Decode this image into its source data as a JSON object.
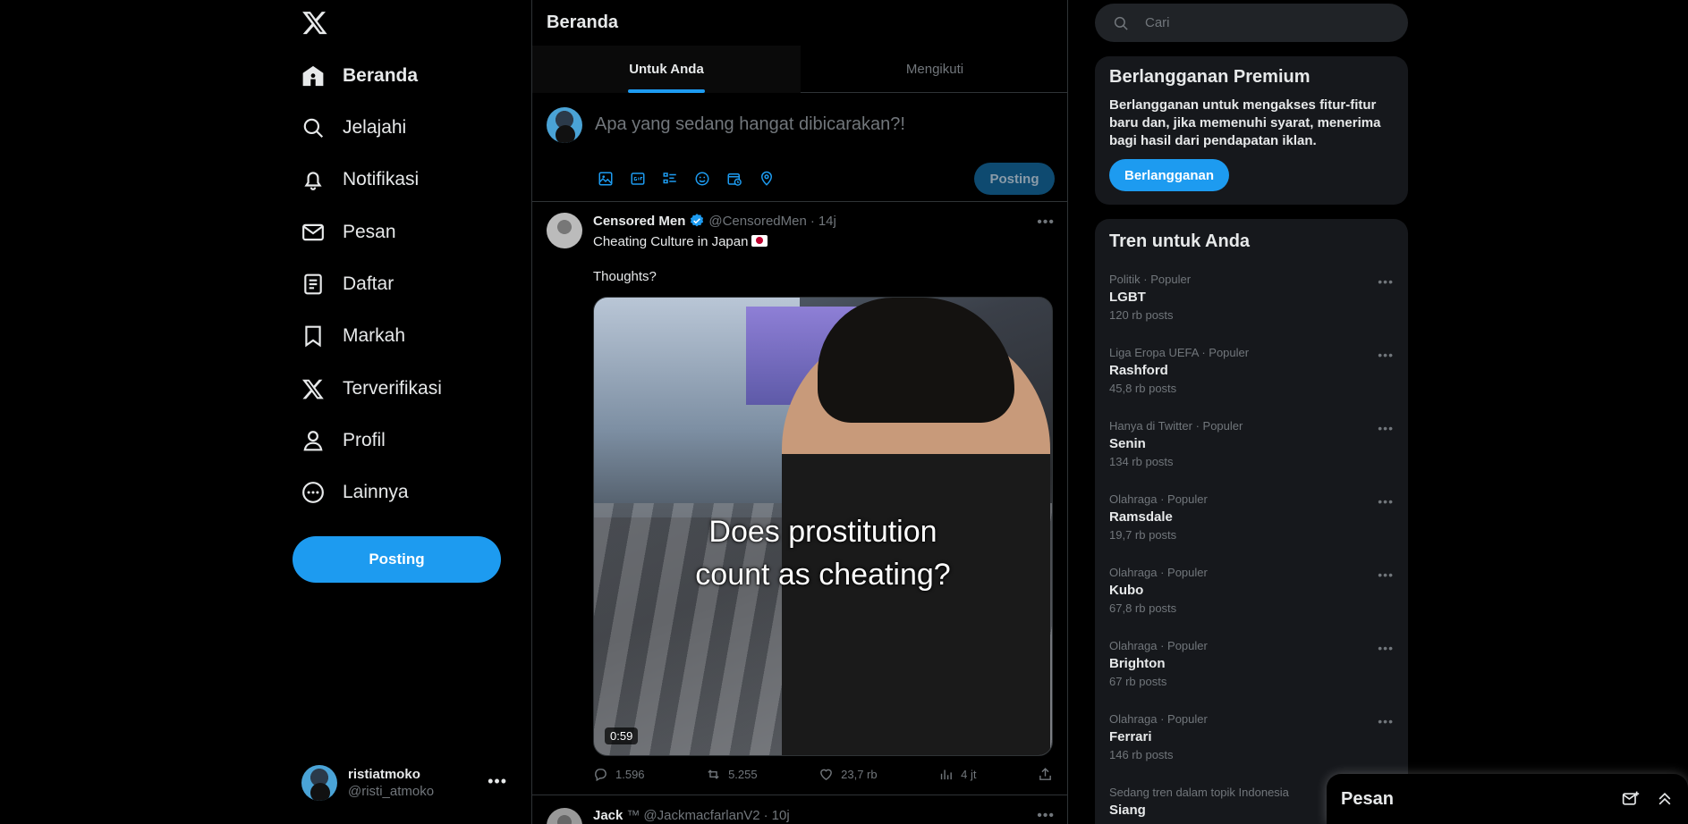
{
  "sidebar": {
    "nav": [
      {
        "label": "Beranda",
        "icon": "home-icon"
      },
      {
        "label": "Jelajahi",
        "icon": "search-icon"
      },
      {
        "label": "Notifikasi",
        "icon": "bell-icon"
      },
      {
        "label": "Pesan",
        "icon": "mail-icon"
      },
      {
        "label": "Daftar",
        "icon": "list-icon"
      },
      {
        "label": "Markah",
        "icon": "bookmark-icon"
      },
      {
        "label": "Terverifikasi",
        "icon": "x-logo-icon"
      },
      {
        "label": "Profil",
        "icon": "person-icon"
      },
      {
        "label": "Lainnya",
        "icon": "more-circle-icon"
      }
    ],
    "post_label": "Posting",
    "account": {
      "name": "ristiatmoko",
      "handle": "@risti_atmoko"
    }
  },
  "main": {
    "title": "Beranda",
    "tabs": [
      {
        "label": "Untuk Anda"
      },
      {
        "label": "Mengikuti"
      }
    ],
    "composer": {
      "placeholder": "Apa yang sedang hangat dibicarakan?!",
      "post_label": "Posting"
    },
    "tweet": {
      "name": "Censored Men",
      "handle": "@CensoredMen",
      "time": "14j",
      "text1": "Cheating Culture in Japan",
      "text2": "Thoughts?",
      "caption1": "Does prostitution",
      "caption2": "count as cheating?",
      "duration": "0:59",
      "replies": "1.596",
      "reposts": "5.255",
      "likes": "23,7 rb",
      "views": "4 jt"
    },
    "tweet2": {
      "name": "Jack",
      "handle": "@JackmacfarlanV2",
      "time": "10j",
      "badge": "™"
    }
  },
  "right": {
    "search_placeholder": "Cari",
    "premium": {
      "title": "Berlangganan Premium",
      "body": "Berlangganan untuk mengakses fitur-fitur baru dan, jika memenuhi syarat, menerima bagi hasil dari pendapatan iklan.",
      "button": "Berlangganan"
    },
    "trends_title": "Tren untuk Anda",
    "trends": [
      {
        "ctx": "Politik · Populer",
        "topic": "LGBT",
        "count": "120 rb posts"
      },
      {
        "ctx": "Liga Eropa UEFA · Populer",
        "topic": "Rashford",
        "count": "45,8 rb posts"
      },
      {
        "ctx": "Hanya di Twitter · Populer",
        "topic": "Senin",
        "count": "134 rb posts"
      },
      {
        "ctx": "Olahraga · Populer",
        "topic": "Ramsdale",
        "count": "19,7 rb posts"
      },
      {
        "ctx": "Olahraga · Populer",
        "topic": "Kubo",
        "count": "67,8 rb posts"
      },
      {
        "ctx": "Olahraga · Populer",
        "topic": "Brighton",
        "count": "67 rb posts"
      },
      {
        "ctx": "Olahraga · Populer",
        "topic": "Ferrari",
        "count": "146 rb posts"
      },
      {
        "ctx": "Sedang tren dalam topik Indonesia",
        "topic": "Siang",
        "count": ""
      }
    ]
  },
  "drawer": {
    "title": "Pesan"
  },
  "colors": {
    "accent": "#1d9bf0",
    "background": "#000000",
    "card": "#16181c",
    "muted": "#71767b",
    "text": "#e7e9ea"
  }
}
